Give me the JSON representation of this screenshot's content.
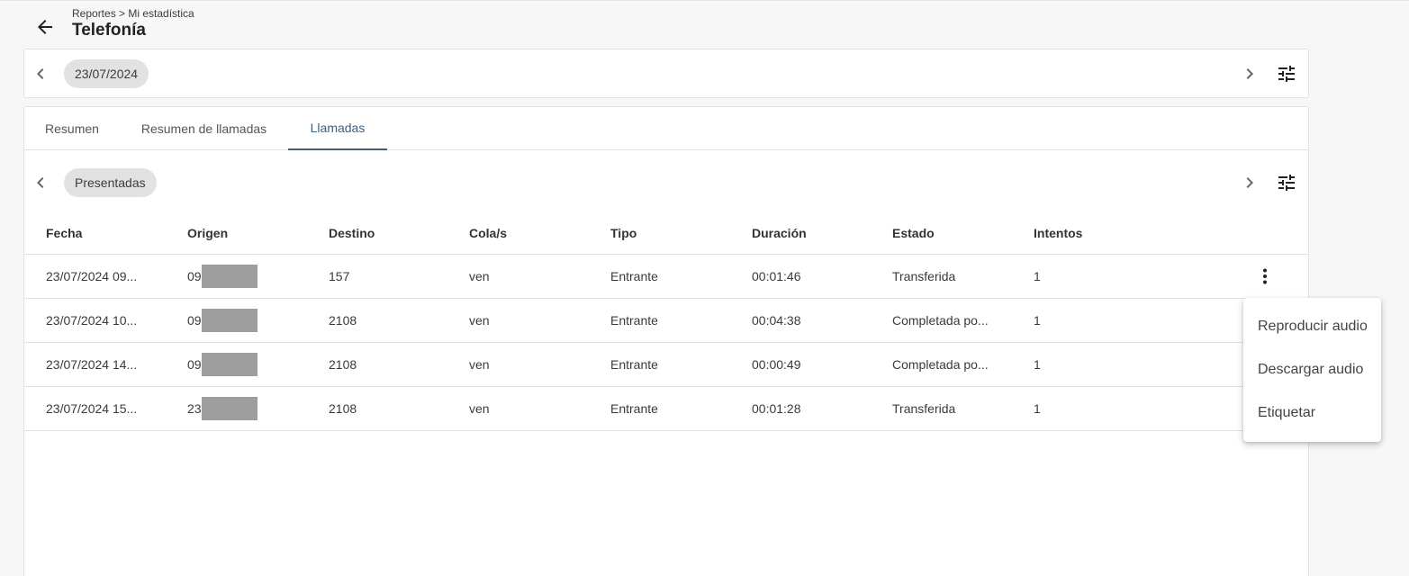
{
  "header": {
    "breadcrumb": "Reportes > Mi estadística",
    "title": "Telefonía"
  },
  "date_filter": {
    "value": "23/07/2024"
  },
  "tabs": [
    {
      "label": "Resumen",
      "active": false
    },
    {
      "label": "Resumen de llamadas",
      "active": false
    },
    {
      "label": "Llamadas",
      "active": true
    }
  ],
  "call_filter": {
    "value": "Presentadas"
  },
  "table": {
    "columns": [
      "Fecha",
      "Origen",
      "Destino",
      "Cola/s",
      "Tipo",
      "Duración",
      "Estado",
      "Intentos"
    ],
    "rows": [
      {
        "fecha": "23/07/2024 09...",
        "origen": "09",
        "destino": "157",
        "cola": "ven",
        "tipo": "Entrante",
        "duracion": "00:01:46",
        "estado": "Transferida",
        "intentos": "1"
      },
      {
        "fecha": "23/07/2024 10...",
        "origen": "09",
        "destino": "2108",
        "cola": "ven",
        "tipo": "Entrante",
        "duracion": "00:04:38",
        "estado": "Completada po...",
        "intentos": "1"
      },
      {
        "fecha": "23/07/2024 14...",
        "origen": "09",
        "destino": "2108",
        "cola": "ven",
        "tipo": "Entrante",
        "duracion": "00:00:49",
        "estado": "Completada po...",
        "intentos": "1"
      },
      {
        "fecha": "23/07/2024 15...",
        "origen": "23",
        "destino": "2108",
        "cola": "ven",
        "tipo": "Entrante",
        "duracion": "00:01:28",
        "estado": "Transferida",
        "intentos": "1"
      }
    ]
  },
  "context_menu": {
    "items": [
      "Reproducir audio",
      "Descargar audio",
      "Etiquetar"
    ]
  },
  "icons": {
    "back": "arrow-left-icon",
    "prev": "chevron-left-icon",
    "next": "chevron-right-icon",
    "filter": "tune-icon",
    "more": "more-vert-icon"
  },
  "colors": {
    "accent": "#3e5f7b",
    "chip_bg": "#e2e2e2",
    "redaction": "#9d9d9d"
  }
}
